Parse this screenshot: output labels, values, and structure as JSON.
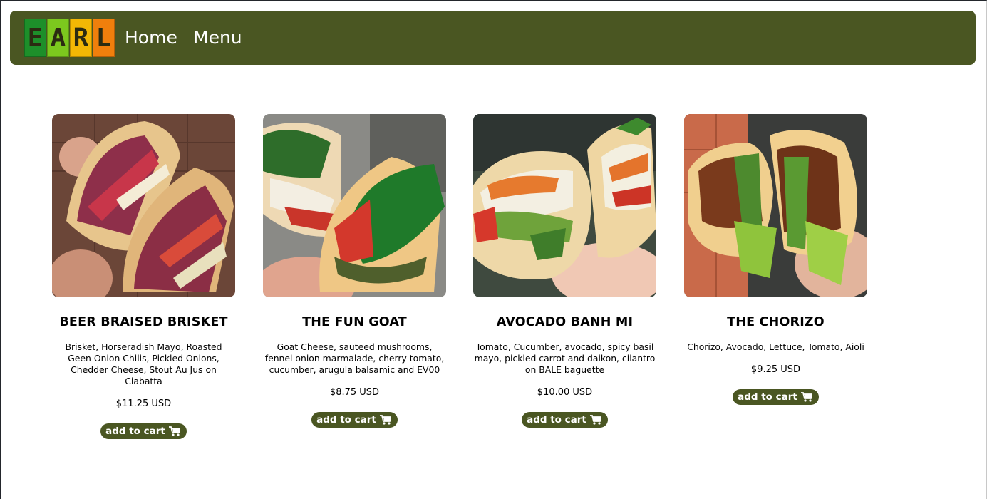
{
  "brand": {
    "logo_letters": [
      "E",
      "A",
      "R",
      "L"
    ],
    "logo_colors": [
      "#1d8f2a",
      "#7cc81e",
      "#f2b705",
      "#f07f0c"
    ]
  },
  "nav": {
    "home": "Home",
    "menu": "Menu"
  },
  "colors": {
    "brand_green": "#4a5622",
    "background": "#ffffff"
  },
  "products": [
    {
      "title": "BEER BRAISED BRISKET",
      "description": "Brisket, Horseradish Mayo, Roasted Geen Onion Chilis, Pickled Onions, Chedder Cheese, Stout Au Jus on Ciabatta",
      "price": "$11.25 USD",
      "button": "add to cart",
      "button_icon": "shopping-cart-icon"
    },
    {
      "title": "THE FUN GOAT",
      "description": "Goat Cheese, sauteed mushrooms, fennel onion marmalade, cherry tomato, cucumber, arugula balsamic and EV00",
      "price": "$8.75 USD",
      "button": "add to cart",
      "button_icon": "shopping-cart-icon"
    },
    {
      "title": "AVOCADO BANH MI",
      "description": "Tomato, Cucumber, avocado, spicy basil mayo, pickled carrot and daikon, cilantro on BALE baguette",
      "price": "$10.00 USD",
      "button": "add to cart",
      "button_icon": "shopping-cart-icon"
    },
    {
      "title": "THE CHORIZO",
      "description": "Chorizo, Avocado, Lettuce, Tomato, Aioli",
      "price": "$9.25 USD",
      "button": "add to cart",
      "button_icon": "shopping-cart-icon"
    }
  ]
}
